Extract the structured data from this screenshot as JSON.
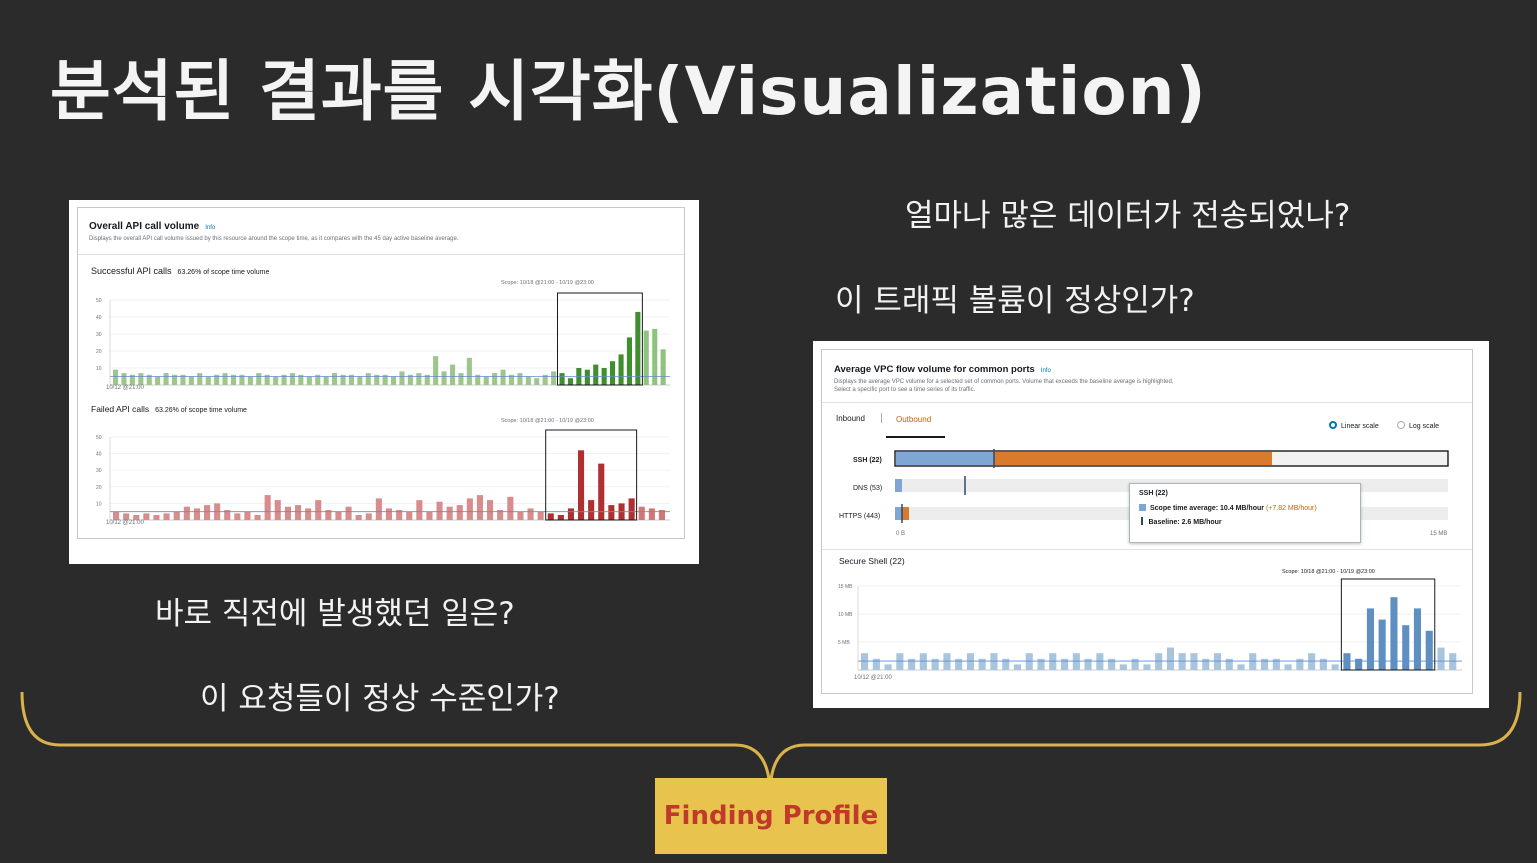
{
  "slide": {
    "title": "분석된 결과를 시각화(Visualization)",
    "questions_right": [
      "얼마나 많은 데이터가 전송되었나?",
      "이 트래픽 볼륨이 정상인가?"
    ],
    "questions_left": [
      "바로 직전에 발생했던 일은?",
      "이 요청들이 정상 수준인가?"
    ],
    "badge": "Finding Profile",
    "colors": {
      "background": "#2b2b2b",
      "brace": "#d8b24a",
      "badge_bg": "#e8c44f",
      "badge_text": "#c0392b"
    }
  },
  "api_panel": {
    "title": "Overall API call volume",
    "info": "Info",
    "description": "Displays the overall API call volume issued by this resource around the scope time, as it compares with the 45 day active baseline average.",
    "successful": {
      "label": "Successful API calls",
      "pct": "63.26% of scope time volume",
      "scope": "Scope: 10/18 @21:00 - 10/19 @23:00",
      "xstart": "10/12 @21:00",
      "yticks": [
        "50",
        "40",
        "30",
        "20",
        "10"
      ]
    },
    "failed": {
      "label": "Failed API calls",
      "pct": "63.26% of scope time volume",
      "scope": "Scope: 10/18 @21:00 - 10/19 @23:00",
      "xstart": "10/12 @21:00",
      "yticks": [
        "50",
        "40",
        "30",
        "20",
        "10"
      ]
    }
  },
  "vpc_panel": {
    "title": "Average VPC flow volume for common ports",
    "info": "Info",
    "description1": "Displays the average VPC volume for a selected set of common ports. Volume that exceeds the baseline average is highlighted.",
    "description2": "Select a specific port to see a time series of its traffic.",
    "tabs": [
      "Inbound",
      "Outbound"
    ],
    "scales": [
      "Linear scale",
      "Log scale"
    ],
    "ports": [
      "SSH (22)",
      "DNS (53)",
      "HTTPS (443)"
    ],
    "axis": [
      "0 B",
      "15 MB"
    ],
    "tooltip": {
      "title": "SSH (22)",
      "avg_label": "Scope time average: 10.4 MB/hour",
      "avg_delta": "(+7.82 MB/hour)",
      "baseline": "Baseline: 2.6 MB/hour"
    },
    "series_title": "Secure Shell (22)",
    "scope": "Scope: 10/18 @21:00 - 10/19 @23:00",
    "yticks": [
      "15 MB",
      "10 MB",
      "5 MB"
    ],
    "xstart": "10/12 @21:00"
  },
  "chart_data": [
    {
      "type": "bar",
      "title": "Successful API calls",
      "ylim": [
        0,
        50
      ],
      "values": [
        9,
        7,
        6,
        7,
        6,
        5,
        7,
        6,
        6,
        5,
        7,
        5,
        6,
        7,
        6,
        6,
        5,
        7,
        6,
        5,
        6,
        7,
        6,
        5,
        6,
        5,
        7,
        6,
        6,
        5,
        7,
        6,
        6,
        5,
        8,
        6,
        7,
        6,
        17,
        8,
        12,
        7,
        16,
        6,
        5,
        7,
        9,
        6,
        7,
        5,
        4,
        6,
        8,
        7,
        4,
        10,
        9,
        12,
        10,
        14,
        18,
        28,
        43,
        32,
        33,
        21
      ],
      "highlight_from": 53,
      "highlight_to": 62,
      "colors": {
        "normal": "#9fc58f",
        "scope": "#3f8f2f",
        "post": "#8fc27e"
      }
    },
    {
      "type": "bar",
      "title": "Failed API calls",
      "ylim": [
        0,
        50
      ],
      "values": [
        5,
        4,
        3,
        4,
        3,
        4,
        5,
        8,
        7,
        9,
        10,
        6,
        4,
        5,
        3,
        15,
        12,
        8,
        9,
        7,
        12,
        6,
        5,
        8,
        3,
        4,
        13,
        7,
        6,
        5,
        12,
        5,
        11,
        8,
        9,
        13,
        15,
        12,
        6,
        14,
        5,
        7,
        5,
        4,
        3,
        7,
        42,
        12,
        34,
        9,
        10,
        13,
        8,
        7,
        6
      ],
      "highlight_from": 43,
      "highlight_to": 51,
      "colors": {
        "normal": "#d98c8c",
        "scope": "#b03030",
        "post": "#d07878"
      }
    },
    {
      "type": "bar",
      "title": "Secure Shell (22)",
      "ylim": [
        0,
        15
      ],
      "values": [
        3,
        2,
        1,
        3,
        2,
        3,
        2,
        3,
        2,
        3,
        2,
        3,
        2,
        1,
        3,
        2,
        3,
        2,
        3,
        2,
        3,
        2,
        1,
        2,
        1,
        3,
        4,
        3,
        3,
        2,
        3,
        2,
        1,
        3,
        2,
        2,
        1,
        2,
        3,
        2,
        1,
        3,
        2,
        11,
        9,
        13,
        8,
        11,
        7,
        4,
        3
      ],
      "highlight_from": 41,
      "highlight_to": 48,
      "colors": {
        "normal": "#a9c4dd",
        "scope": "#5f8fc0",
        "post": "#a9c4dd"
      }
    }
  ]
}
